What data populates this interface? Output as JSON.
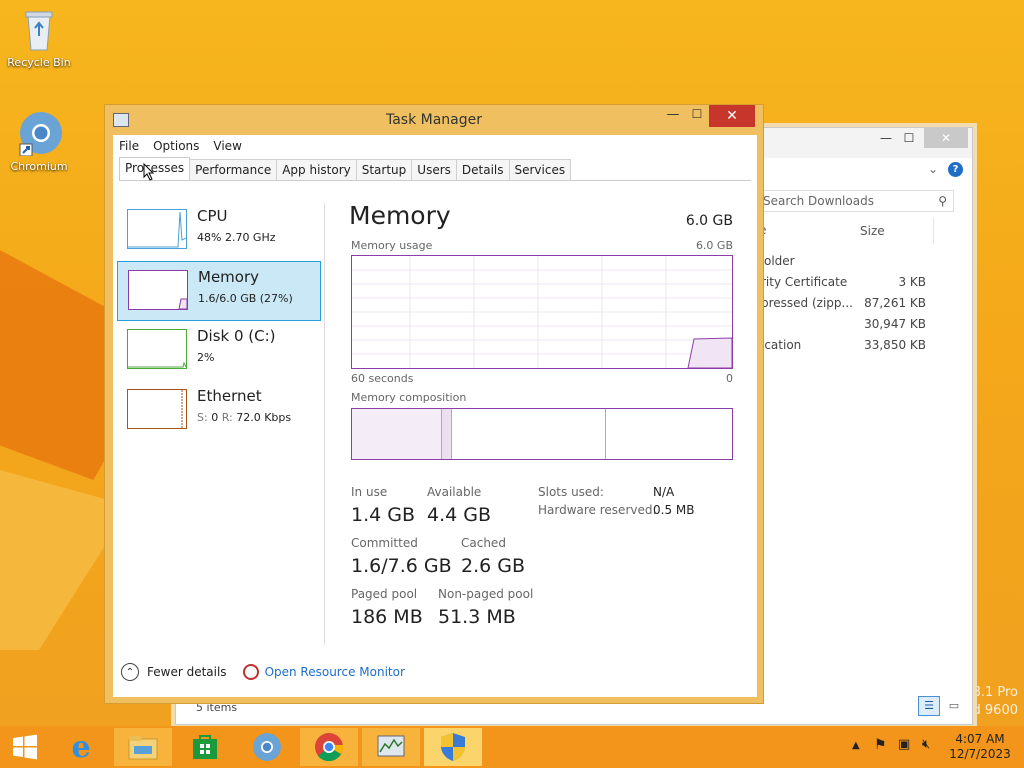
{
  "desktop": {
    "icons": [
      {
        "label": "Recycle Bin"
      },
      {
        "label": "Chromium"
      }
    ],
    "watermark": [
      "8.1 Pro",
      "d 9600"
    ]
  },
  "explorer": {
    "search_placeholder": "Search Downloads",
    "col_size": "Size",
    "rows": [
      {
        "name": "older",
        "size": ""
      },
      {
        "name": "rity Certificate",
        "size": "3 KB"
      },
      {
        "name": "pressed (zipp...",
        "size": "87,261 KB"
      },
      {
        "name": "",
        "size": "30,947 KB"
      },
      {
        "name": "ication",
        "size": "33,850 KB"
      }
    ],
    "status": "5 items"
  },
  "taskmanager": {
    "title": "Task Manager",
    "menu": [
      "File",
      "Options",
      "View"
    ],
    "tabs": [
      "Processes",
      "Performance",
      "App history",
      "Startup",
      "Users",
      "Details",
      "Services"
    ],
    "sidebar": [
      {
        "name": "CPU",
        "value": "48% 2.70 GHz",
        "color": "#4aa0d8"
      },
      {
        "name": "Memory",
        "value": "1.6/6.0 GB (27%)",
        "color": "#8b3fa6"
      },
      {
        "name": "Disk 0 (C:)",
        "value": "2%",
        "color": "#4da83a"
      },
      {
        "name": "Ethernet",
        "value_s": "S:",
        "value_s_num": "0",
        "value_r": "R:",
        "value_r_num": "72.0 Kbps",
        "color": "#a7541b"
      }
    ],
    "main": {
      "heading": "Memory",
      "total": "6.0 GB",
      "usage_label": "Memory usage",
      "usage_max": "6.0 GB",
      "axis_left": "60 seconds",
      "axis_right": "0",
      "composition_label": "Memory composition",
      "stats": {
        "in_use_label": "In use",
        "in_use": "1.4 GB",
        "available_label": "Available",
        "available": "4.4 GB",
        "committed_label": "Committed",
        "committed": "1.6/7.6 GB",
        "cached_label": "Cached",
        "cached": "2.6 GB",
        "paged_label": "Paged pool",
        "paged": "186 MB",
        "nonpaged_label": "Non-paged pool",
        "nonpaged": "51.3 MB",
        "slots_label": "Slots used:",
        "slots": "N/A",
        "hw_label": "Hardware reserved:",
        "hw": "0.5 MB"
      }
    },
    "footer": {
      "fewer": "Fewer details",
      "monitor": "Open Resource Monitor"
    }
  },
  "taskbar": {
    "time": "4:07 AM",
    "date": "12/7/2023"
  }
}
